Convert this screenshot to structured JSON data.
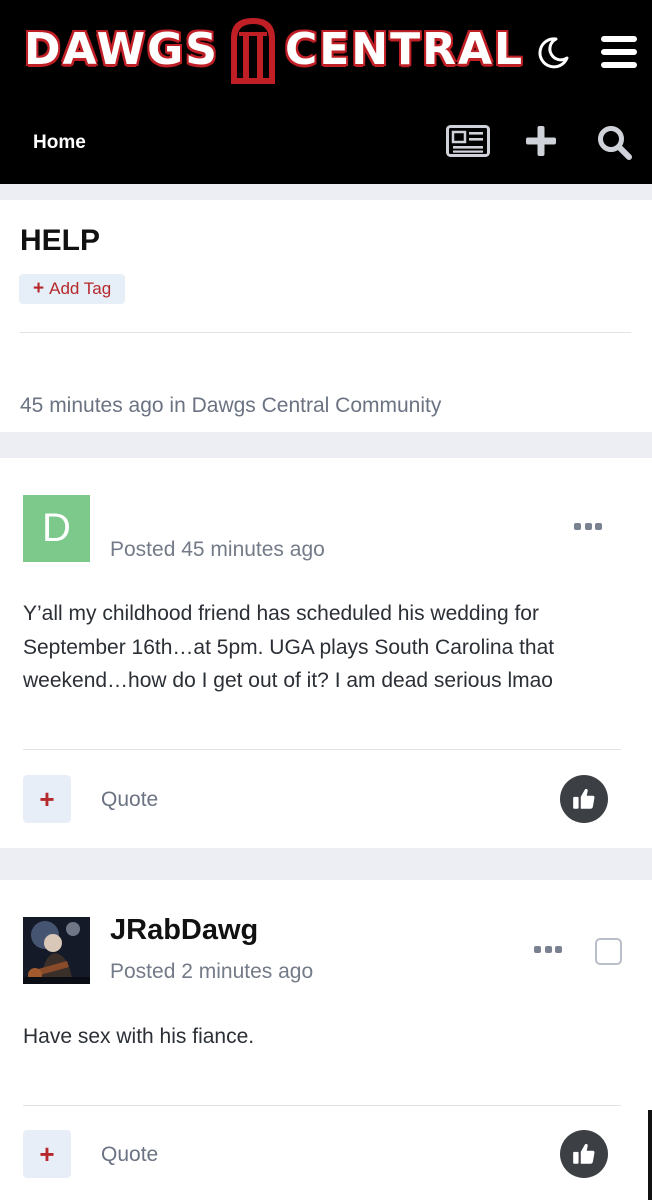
{
  "header": {
    "logo_left": "DAWGS",
    "logo_right": "CENTRAL",
    "nav_home": "Home",
    "icons": [
      "moon-icon",
      "menu-icon",
      "newspaper-icon",
      "plus-icon",
      "search-icon"
    ]
  },
  "topic": {
    "title": "HELP",
    "add_tag_label": "Add Tag",
    "meta": "45 minutes ago in Dawgs Central Community"
  },
  "posts": [
    {
      "avatar_letter": "D",
      "author": "",
      "time": "Posted 45 minutes ago",
      "body": "Y’all my childhood friend has scheduled his wedding for September 16th…at 5pm. UGA plays South Carolina that weekend…how do I get out of it? I am dead serious lmao",
      "quote_label": "Quote"
    },
    {
      "author": "JRabDawg",
      "time": "Posted 2 minutes ago",
      "body": "Have sex with his fiance.",
      "quote_label": "Quote"
    }
  ],
  "colors": {
    "accent_red": "#c01f26",
    "header_bg": "#000000",
    "avatar_green": "#7cc98b",
    "tag_bg": "#e6eef7",
    "like_bg": "#3c3f44"
  }
}
